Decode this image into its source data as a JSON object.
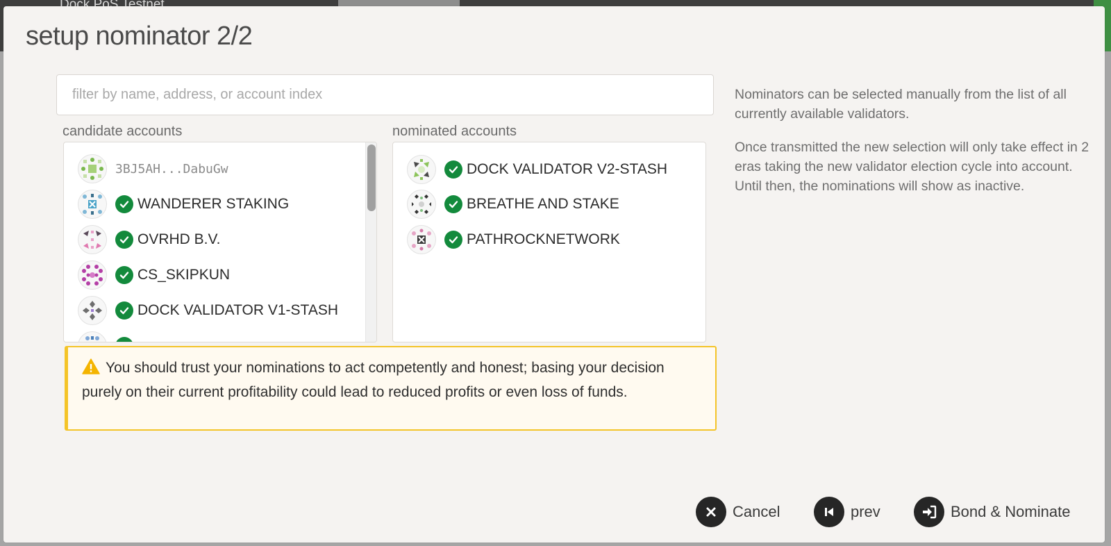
{
  "background": {
    "app_title": "Dock PoS Testnet"
  },
  "modal": {
    "title": "setup nominator 2/2",
    "filter": {
      "placeholder": "filter by name, address, or account index",
      "value": ""
    },
    "candidates": {
      "label": "candidate accounts",
      "items": [
        {
          "name": "3BJ5AH...DabuGw",
          "verified": false,
          "is_address": true
        },
        {
          "name": "WANDERER STAKING",
          "verified": true
        },
        {
          "name": "OVRHD B.V.",
          "verified": true
        },
        {
          "name": "CS_SKIPKUN",
          "verified": true
        },
        {
          "name": "DOCK VALIDATOR V1-STASH",
          "verified": true
        }
      ]
    },
    "nominated": {
      "label": "nominated accounts",
      "items": [
        {
          "name": "DOCK VALIDATOR V2-STASH",
          "verified": true
        },
        {
          "name": "BREATHE AND STAKE",
          "verified": true
        },
        {
          "name": "PATHROCKNETWORK",
          "verified": true
        }
      ]
    },
    "warning": {
      "icon": "warning-triangle-icon",
      "text": "You should trust your nominations to act competently and honest; basing your decision purely on their current profitability could lead to reduced profits or even loss of funds."
    },
    "help": {
      "paragraph1": "Nominators can be selected manually from the list of all currently available validators.",
      "paragraph2": "Once transmitted the new selection will only take effect in 2 eras taking the new validator election cycle into account. Until then, the nominations will show as inactive."
    },
    "actions": {
      "cancel_label": "Cancel",
      "prev_label": "prev",
      "bond_label": "Bond & Nominate"
    }
  },
  "colors": {
    "check_green": "#138a3c",
    "warning_border": "#f4c428",
    "button_dark": "#262626",
    "modal_bg": "#f5f3f1"
  }
}
